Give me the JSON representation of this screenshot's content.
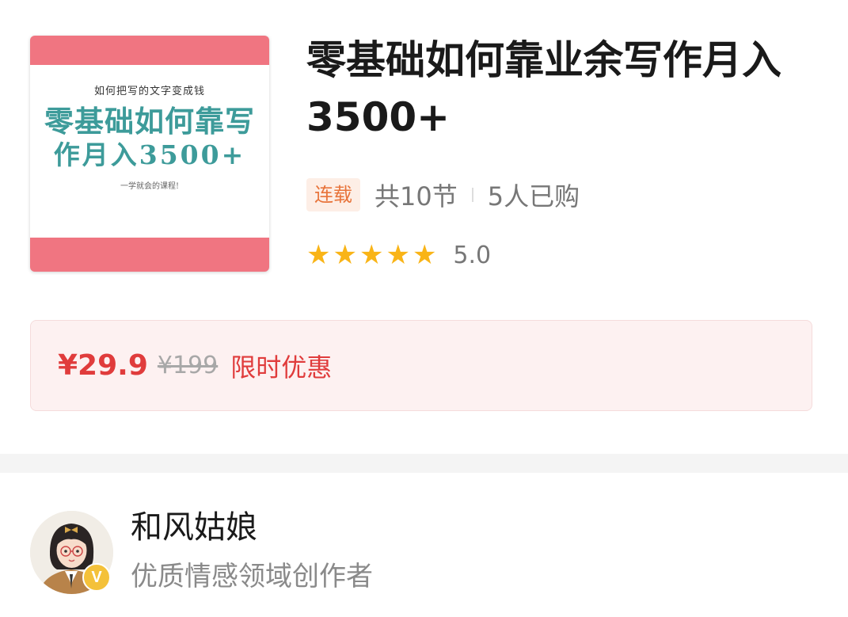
{
  "cover": {
    "subtitle": "如何把写的文字变成钱",
    "line1": "零基础如何靠写",
    "line2": "作月入3500+",
    "tagline": "一学就会的课程!",
    "colors": {
      "band": "#f07581",
      "text": "#3d9b9a"
    }
  },
  "course": {
    "title": "零基础如何靠业余写作月入3500+",
    "badge": "连载",
    "lessons": "共10节",
    "purchased": "5人已购",
    "rating": "5.0",
    "star_count": 5
  },
  "price": {
    "current": "¥29.9",
    "original": "¥199",
    "promo_label": "限时优惠"
  },
  "author": {
    "name": "和风姑娘",
    "description": "优质情感领域创作者",
    "verified_badge": "V"
  },
  "colors": {
    "accent_red": "#e03c3c",
    "badge_orange": "#e8743b",
    "star_yellow": "#f9b417"
  }
}
